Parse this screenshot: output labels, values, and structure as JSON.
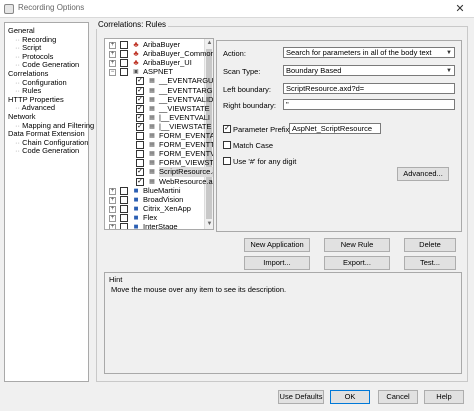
{
  "window": {
    "title": "Recording Options",
    "close_glyph": "✕"
  },
  "nav": [
    {
      "label": "General",
      "level": 0
    },
    {
      "label": "Recording",
      "level": 1
    },
    {
      "label": "Script",
      "level": 1
    },
    {
      "label": "Protocols",
      "level": 1
    },
    {
      "label": "Code Generation",
      "level": 1
    },
    {
      "label": "Correlations",
      "level": 0
    },
    {
      "label": "Configuration",
      "level": 1
    },
    {
      "label": "Rules",
      "level": 1
    },
    {
      "label": "HTTP Properties",
      "level": 0
    },
    {
      "label": "Advanced",
      "level": 1
    },
    {
      "label": "Network",
      "level": 0
    },
    {
      "label": "Mapping and Filtering",
      "level": 1
    },
    {
      "label": "Data Format Extension",
      "level": 0
    },
    {
      "label": "Chain Configuration",
      "level": 1
    },
    {
      "label": "Code Generation",
      "level": 1
    }
  ],
  "correlations": {
    "group_label": "Correlations: Rules",
    "tree": [
      {
        "label": "AribaBuyer",
        "level": 0,
        "expander": "+",
        "checked": false,
        "icon": "ariba-icon"
      },
      {
        "label": "AribaBuyer_Commor",
        "level": 0,
        "expander": "+",
        "checked": false,
        "icon": "ariba-icon"
      },
      {
        "label": "AribaBuyer_UI",
        "level": 0,
        "expander": "+",
        "checked": false,
        "icon": "ariba-icon"
      },
      {
        "label": "ASPNET",
        "level": 0,
        "expander": "−",
        "checked": false,
        "icon": "aspnet-icon"
      },
      {
        "label": "__EVENTARGUM",
        "level": 1,
        "checked": true,
        "icon": "rule-icon"
      },
      {
        "label": "__EVENTTARGE",
        "level": 1,
        "checked": true,
        "icon": "rule-icon"
      },
      {
        "label": "__EVENTVALID/",
        "level": 1,
        "checked": true,
        "icon": "rule-icon"
      },
      {
        "label": "__VIEWSTATE",
        "level": 1,
        "checked": true,
        "icon": "rule-icon"
      },
      {
        "label": "|__EVENTVALI",
        "level": 1,
        "checked": true,
        "icon": "rule-icon"
      },
      {
        "label": "|__VIEWSTATE",
        "level": 1,
        "checked": true,
        "icon": "rule-icon"
      },
      {
        "label": "FORM_EVENTAR",
        "level": 1,
        "checked": false,
        "icon": "rule-icon"
      },
      {
        "label": "FORM_EVENTTA",
        "level": 1,
        "checked": false,
        "icon": "rule-icon"
      },
      {
        "label": "FORM_EVENTVA",
        "level": 1,
        "checked": false,
        "icon": "rule-icon"
      },
      {
        "label": "FORM_VIEWSTA",
        "level": 1,
        "checked": false,
        "icon": "rule-icon"
      },
      {
        "label": "ScriptResource.a:",
        "level": 1,
        "checked": true,
        "icon": "rule-icon",
        "selected": true
      },
      {
        "label": "WebResource.axd",
        "level": 1,
        "checked": true,
        "icon": "rule-icon"
      },
      {
        "label": "BlueMartini",
        "level": 0,
        "expander": "+",
        "checked": false,
        "icon": "app-icon"
      },
      {
        "label": "BroadVision",
        "level": 0,
        "expander": "+",
        "checked": false,
        "icon": "app-icon"
      },
      {
        "label": "Citrix_XenApp",
        "level": 0,
        "expander": "+",
        "checked": false,
        "icon": "app-icon"
      },
      {
        "label": "Flex",
        "level": 0,
        "expander": "+",
        "checked": false,
        "icon": "app-icon"
      },
      {
        "label": "InterStage",
        "level": 0,
        "expander": "+",
        "checked": false,
        "icon": "app-icon"
      }
    ]
  },
  "props": {
    "action_label": "Action:",
    "action_value": "Search for parameters in all of the body text",
    "scan_label": "Scan Type:",
    "scan_value": "Boundary Based",
    "left_label": "Left boundary:",
    "left_value": "ScriptResource.axd?d=",
    "right_label": "Right boundary:",
    "right_value": "\"",
    "param_prefix_label": "Parameter Prefix:",
    "param_prefix_checked": true,
    "param_prefix_value": "AspNet_ScriptResource",
    "match_case_label": "Match Case",
    "match_case_checked": false,
    "use_hash_label": "Use '#' for any digit",
    "use_hash_checked": false,
    "advanced_button": "Advanced..."
  },
  "rule_buttons": {
    "new_application": "New Application",
    "new_rule": "New Rule",
    "delete": "Delete",
    "import": "Import...",
    "export": "Export...",
    "test": "Test..."
  },
  "hint": {
    "title": "Hint",
    "text": "Move the mouse over any item to see its description."
  },
  "footer": {
    "use_defaults": "Use Defaults",
    "ok": "OK",
    "cancel": "Cancel",
    "help": "Help"
  }
}
